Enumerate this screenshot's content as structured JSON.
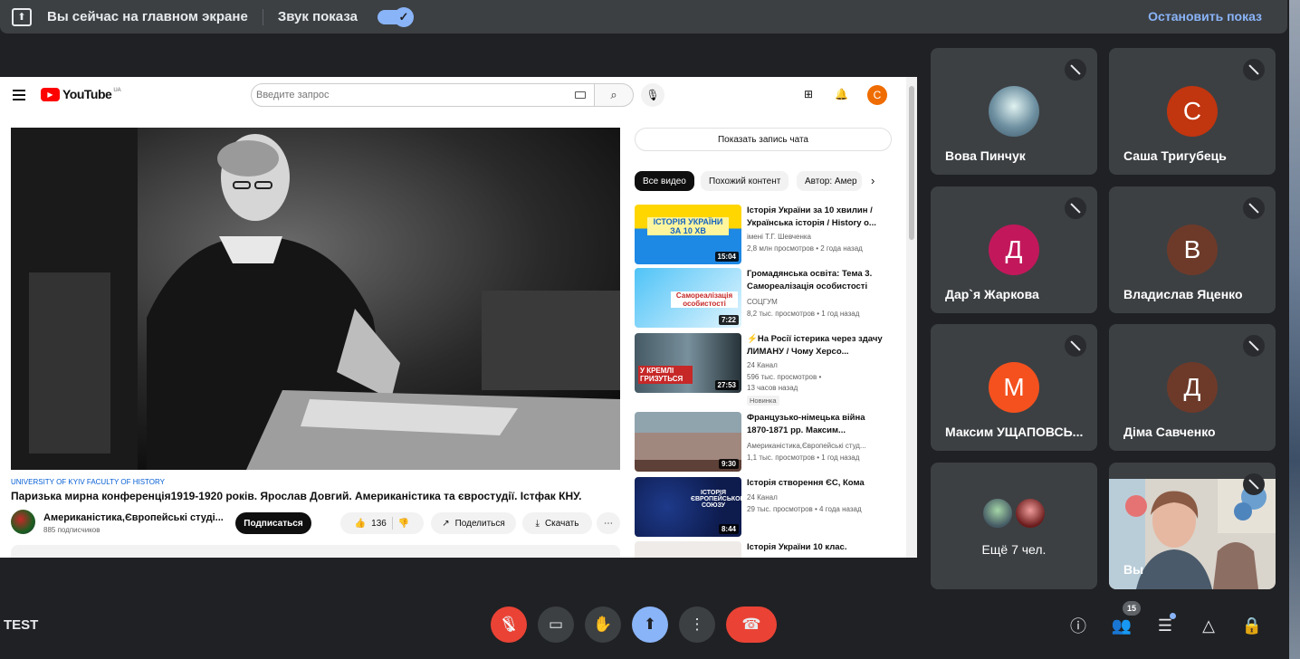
{
  "topbar": {
    "main_screen_msg": "Вы сейчас на главном экране",
    "sound_label": "Звук показа",
    "sound_enabled": true,
    "stop_label": "Остановить показ"
  },
  "youtube": {
    "logo": "YouTube",
    "region": "UA",
    "search_placeholder": "Введите запрос",
    "account_initial": "С",
    "channel_tag": "UNIVERSITY OF KYIV FACULTY OF HISTORY",
    "video_title": "Паризька мирна конференція1919-1920 років. Ярослав Довгий. Американістика та євростудії. Істфак КНУ.",
    "channel_name": "Американістика,Європейські студі...",
    "subscribers": "885 подписчиков",
    "subscribe_label": "Подписаться",
    "likes": "136",
    "share_label": "Поделиться",
    "download_label": "Скачать",
    "chat_replay_label": "Показать запись чата",
    "chips": [
      "Все видео",
      "Похожий контент",
      "Автор: Амер"
    ],
    "recommendations": [
      {
        "title": "Історія України за 10 хвилин / Українська історія / History o...",
        "channel": "імені Т.Г. Шевченка",
        "meta": "2,8 млн просмотров • 2 года назад",
        "duration": "15:04",
        "thumb_text": "ІСТОРІЯ УКРАЇНИ ЗА 10 ХВ"
      },
      {
        "title": "Громадянська освіта: Тема 3. Самореалізація особистості",
        "channel": "СОЦГУМ",
        "meta": "8,2 тыс. просмотров • 1 год назад",
        "duration": "7:22",
        "thumb_text": "Самореалізація особистості"
      },
      {
        "title": "⚡На Росії істерика через здачу ЛИМАНУ / Чому Херсо...",
        "channel": "24 Канал",
        "meta": "596 тыс. просмотров • 13 часов назад",
        "duration": "27:53",
        "badge": "Новинка",
        "thumb_text": "У КРЕМЛІ ГРИЗУТЬСЯ"
      },
      {
        "title": "Французько-німецька війна 1870-1871 рр. Максим...",
        "channel": "Американістика,Європейські студ...",
        "meta": "1,1 тыс. просмотров • 1 год назад",
        "duration": "9:30"
      },
      {
        "title": "Історія створення ЄС, Кома",
        "channel": "24 Канал",
        "meta": "29 тыс. просмотров • 4 года назад",
        "duration": "8:44",
        "thumb_text": "ІСТОРІЯ ЄВРОПЕЙСЬКОГО СОЮЗУ"
      },
      {
        "title": "Історія України 10 клас.",
        "channel": "",
        "meta": "",
        "duration": ""
      }
    ]
  },
  "participants": [
    {
      "name": "Вова Пинчук",
      "initial": "",
      "color": "#5d7c8c"
    },
    {
      "name": "Саша Тригубець",
      "initial": "С",
      "color": "#c1350f"
    },
    {
      "name": "Дар`я Жаркова",
      "initial": "Д",
      "color": "#c2185b"
    },
    {
      "name": "Владислав Яценко",
      "initial": "В",
      "color": "#6d3a2a"
    },
    {
      "name": "Максим УЩАПОВСЬ...",
      "initial": "М",
      "color": "#f4511e"
    },
    {
      "name": "Діма Савченко",
      "initial": "Д",
      "color": "#6d3a2a"
    }
  ],
  "more_tile": {
    "label": "Ещё 7 чел."
  },
  "self_tile": {
    "label": "Вы"
  },
  "bottom": {
    "meeting_name": "TEST",
    "participants_count": "15"
  },
  "colors": {
    "accent": "#8ab4f8",
    "danger": "#ea4335",
    "tile": "#3c4043",
    "background": "#202124"
  }
}
